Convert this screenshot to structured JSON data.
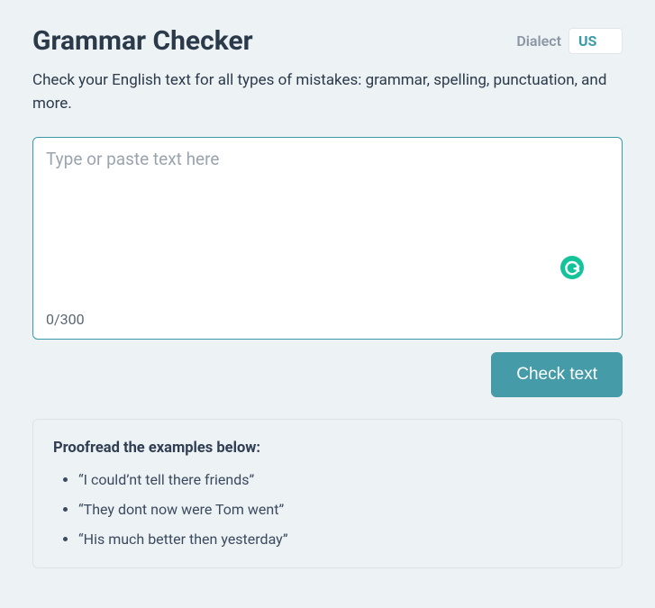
{
  "header": {
    "title": "Grammar Checker",
    "dialect_label": "Dialect",
    "dialect_value": "US"
  },
  "subtitle": "Check your English text for all types of mistakes: grammar, spelling, punctuation, and more.",
  "editor": {
    "value": "",
    "placeholder": "Type or paste text here",
    "counter": "0/300"
  },
  "actions": {
    "check_label": "Check text"
  },
  "examples": {
    "heading": "Proofread the examples below:",
    "items": [
      "“I could’nt tell there friends”",
      "“They dont now were Tom went”",
      "“His much better then yesterday”"
    ]
  }
}
